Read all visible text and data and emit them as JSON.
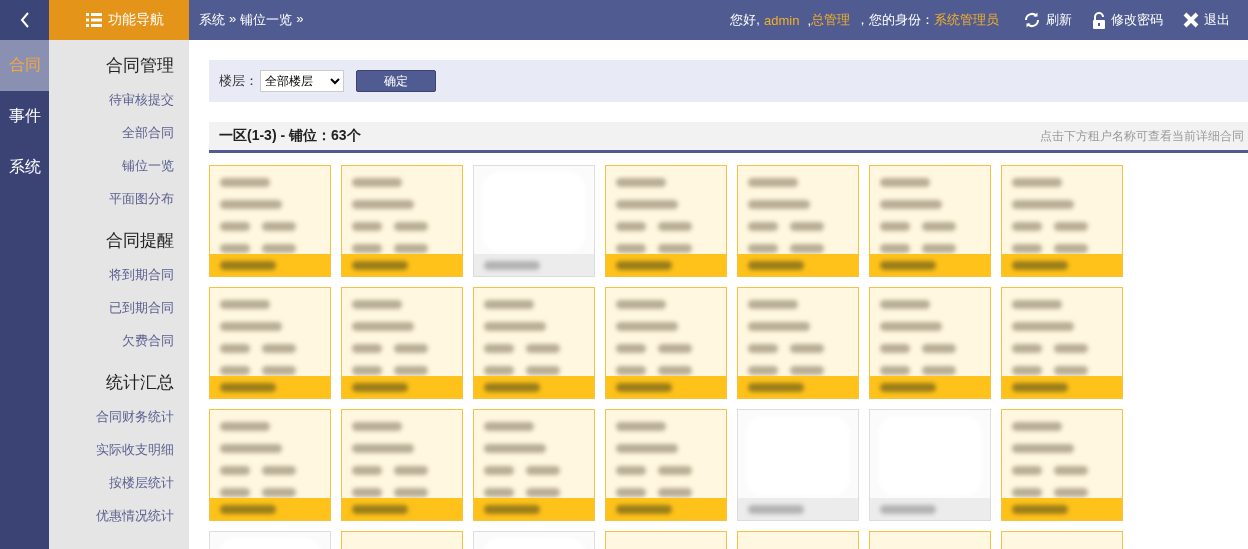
{
  "header": {
    "nav_title": "功能导航",
    "breadcrumb": [
      "系统",
      "铺位一览"
    ],
    "breadcrumb_sep": "»",
    "greeting": "您好,",
    "user": "admin",
    "org_sep": ",",
    "org": "总管理",
    "role_label": "，您的身份：",
    "role": "系统管理员",
    "actions": [
      {
        "kind": "refresh",
        "label": "刷新"
      },
      {
        "kind": "lock",
        "label": "修改密码"
      },
      {
        "kind": "exit",
        "label": "退出"
      }
    ]
  },
  "rail": [
    {
      "label": "合同",
      "selected": true
    },
    {
      "label": "事件",
      "selected": false
    },
    {
      "label": "系统",
      "selected": false
    }
  ],
  "menu": [
    {
      "title": "合同管理",
      "items": [
        "待审核提交",
        "全部合同",
        "铺位一览",
        "平面图分布"
      ]
    },
    {
      "title": "合同提醒",
      "items": [
        "将到期合同",
        "已到期合同",
        "欠费合同"
      ]
    },
    {
      "title": "统计汇总",
      "items": [
        "合同财务统计",
        "实际收支明细",
        "按楼层统计",
        "优惠情况统计"
      ]
    }
  ],
  "filter": {
    "label": "楼层：",
    "floor": "全部楼层",
    "button": "确定"
  },
  "section": {
    "title": "一区(1-3) - 铺位：63个",
    "hint": "点击下方租户名称可查看当前详细合同"
  },
  "cards": [
    {
      "kind": "occupied"
    },
    {
      "kind": "occupied"
    },
    {
      "kind": "vacant"
    },
    {
      "kind": "occupied"
    },
    {
      "kind": "occupied"
    },
    {
      "kind": "occupied"
    },
    {
      "kind": "occupied"
    },
    {
      "kind": "occupied"
    },
    {
      "kind": "occupied"
    },
    {
      "kind": "occupied"
    },
    {
      "kind": "occupied"
    },
    {
      "kind": "occupied"
    },
    {
      "kind": "occupied"
    },
    {
      "kind": "occupied"
    },
    {
      "kind": "occupied"
    },
    {
      "kind": "occupied"
    },
    {
      "kind": "occupied"
    },
    {
      "kind": "occupied"
    },
    {
      "kind": "vacant"
    },
    {
      "kind": "vacant"
    },
    {
      "kind": "occupied"
    },
    {
      "kind": "vacant"
    },
    {
      "kind": "occupied"
    },
    {
      "kind": "vacant"
    },
    {
      "kind": "occupied"
    },
    {
      "kind": "occupied"
    },
    {
      "kind": "occupied"
    },
    {
      "kind": "occupied"
    }
  ]
}
